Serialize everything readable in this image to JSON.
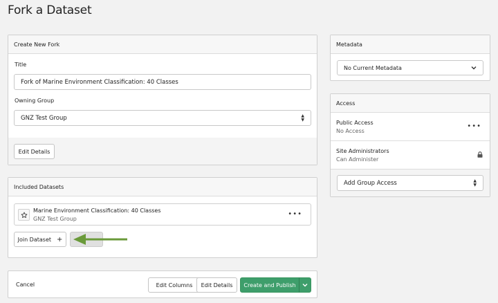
{
  "page": {
    "title": "Fork a Dataset"
  },
  "create_fork": {
    "header": "Create New Fork",
    "title_label": "Title",
    "title_value": "Fork of Marine Environment Classification: 40 Classes",
    "owning_group_label": "Owning Group",
    "owning_group_value": "GNZ Test Group",
    "edit_details_label": "Edit Details"
  },
  "included_datasets": {
    "header": "Included Datasets",
    "items": [
      {
        "name": "Marine Environment Classification: 40 Classes",
        "group": "GNZ Test Group"
      }
    ],
    "join_dataset_label": "Join Dataset",
    "join_dataset_icon": "+",
    "arrow_color": "#6a9a3a"
  },
  "footer": {
    "cancel_label": "Cancel",
    "edit_columns_label": "Edit Columns",
    "edit_details_label": "Edit Details",
    "create_publish_label": "Create and Publish",
    "accent": "#3e9e6b"
  },
  "metadata": {
    "header": "Metadata",
    "select_value": "No Current Metadata"
  },
  "access": {
    "header": "Access",
    "rows": [
      {
        "title": "Public Access",
        "subtitle": "No Access",
        "action_icon": "more-icon"
      },
      {
        "title": "Site Administrators",
        "subtitle": "Can Administer",
        "action_icon": "lock-icon"
      }
    ],
    "add_group_label": "Add Group Access"
  }
}
